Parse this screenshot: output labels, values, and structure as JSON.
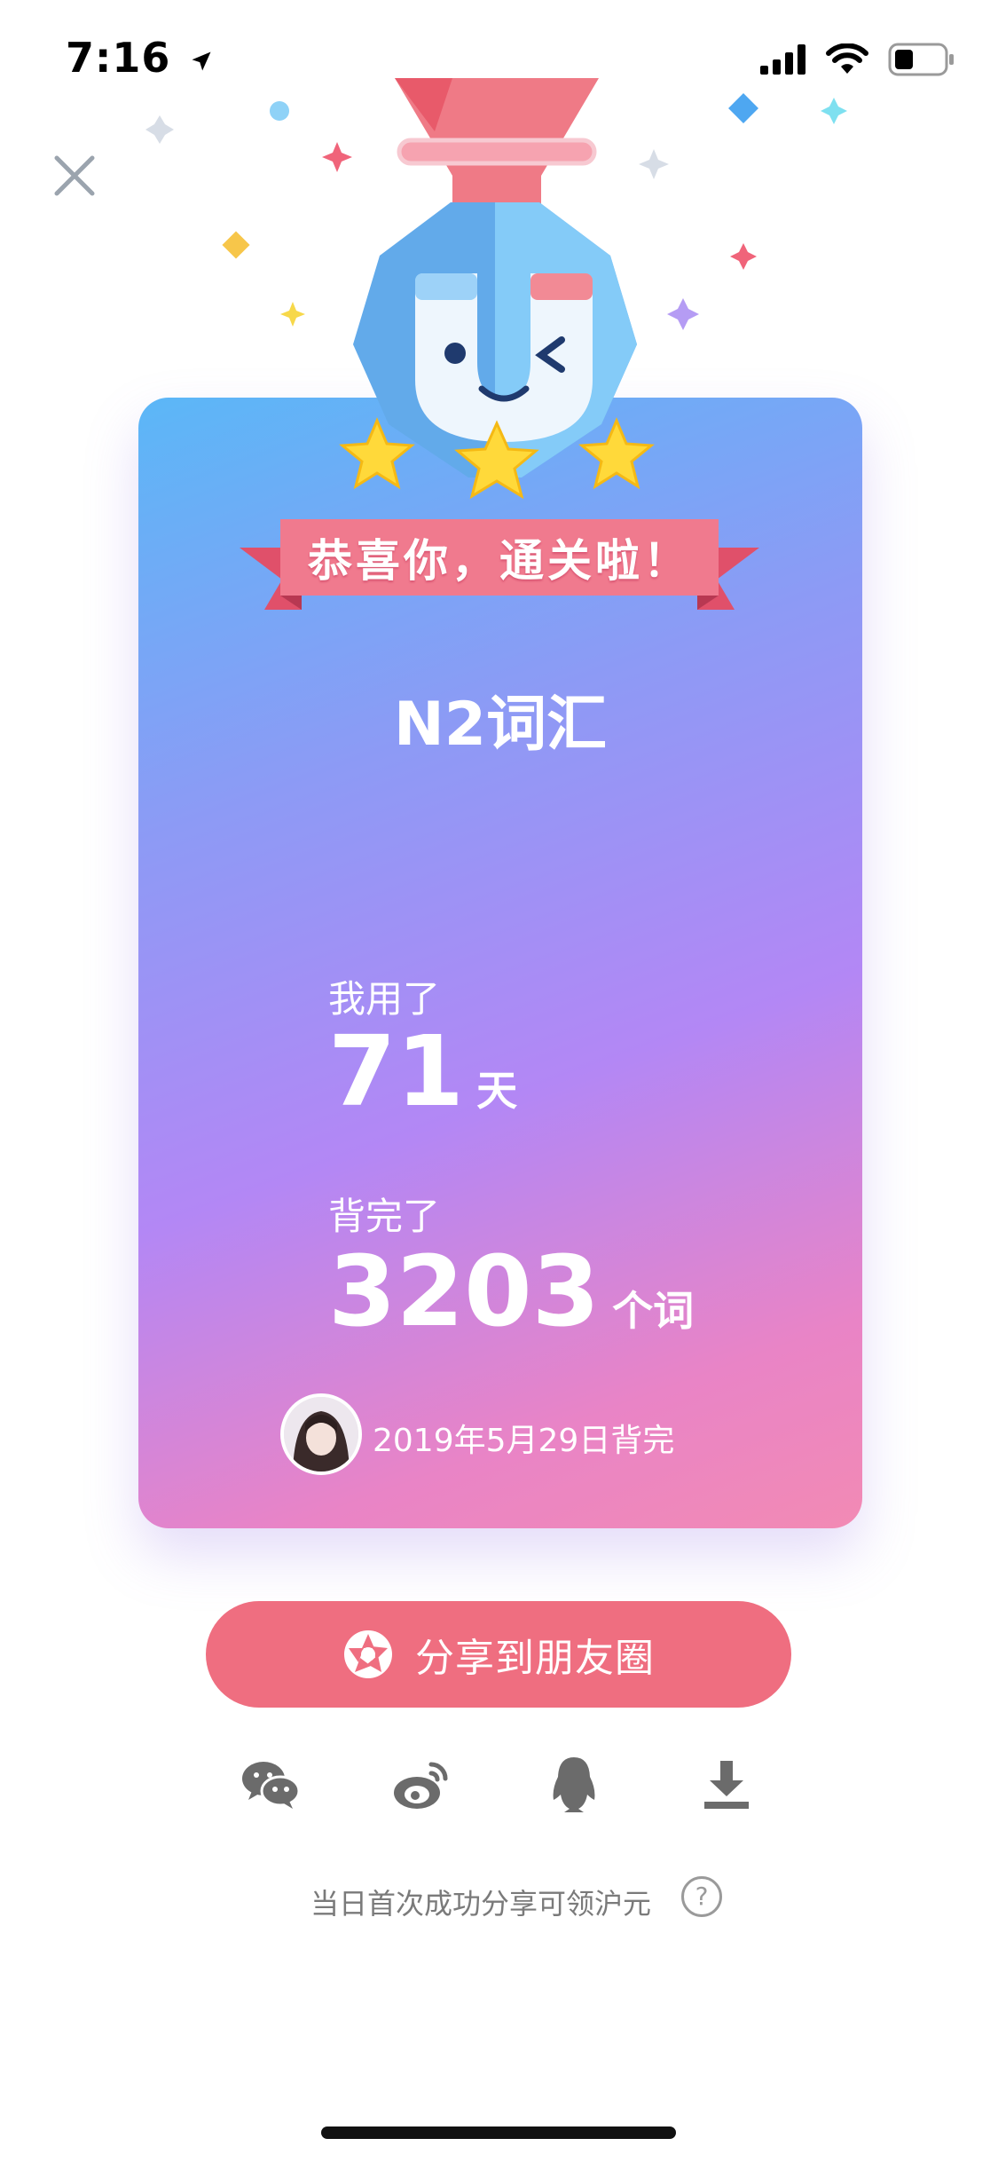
{
  "status_bar": {
    "time": "7:16"
  },
  "card": {
    "banner_text": "恭喜你，通关啦！",
    "deck_title": "N2词汇",
    "days_label": "我用了",
    "days_value": "71",
    "days_unit": "天",
    "words_label": "背完了",
    "words_value": "3203",
    "words_unit": "个词",
    "finish_date": "2019年5月29日背完"
  },
  "share": {
    "primary_button_label": "分享到朋友圈",
    "targets": [
      "wechat-icon",
      "weibo-icon",
      "qq-icon",
      "download-icon"
    ]
  },
  "promo_text": "当日首次成功分享可领沪元",
  "help_glyph": "?",
  "colors": {
    "share_button": "#ef6e80",
    "card_gradient_start": "#5bb7f7",
    "card_gradient_mid": "#b387f5",
    "card_gradient_end": "#f28ab4"
  }
}
